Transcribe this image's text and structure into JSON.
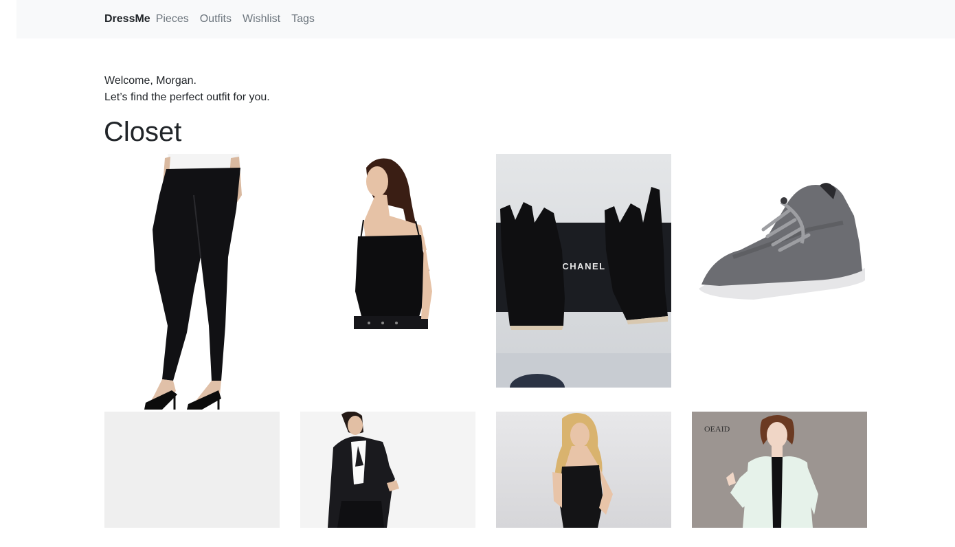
{
  "nav": {
    "brand": "DressMe",
    "links": [
      "Pieces",
      "Outfits",
      "Wishlist",
      "Tags"
    ]
  },
  "welcome": {
    "line1": "Welcome, Morgan.",
    "line2": "Let’s find the perfect outfit for you."
  },
  "closet": {
    "title": "Closet",
    "items": [
      {
        "name": "black pants with heels"
      },
      {
        "name": "black velvet camisole"
      },
      {
        "name": "black leather fingerless gloves",
        "box_text": "CHANEL"
      },
      {
        "name": "grey wool sneaker"
      },
      {
        "name": "blank placeholder"
      },
      {
        "name": "black blazer outfit"
      },
      {
        "name": "black shapewear dress"
      },
      {
        "name": "white blazer",
        "watermark": "OEAID"
      }
    ]
  },
  "colors": {
    "navbar_bg": "#f8f9fa",
    "brand": "#212529",
    "nav_link": "#6c757d",
    "placeholder": "#efefef"
  }
}
